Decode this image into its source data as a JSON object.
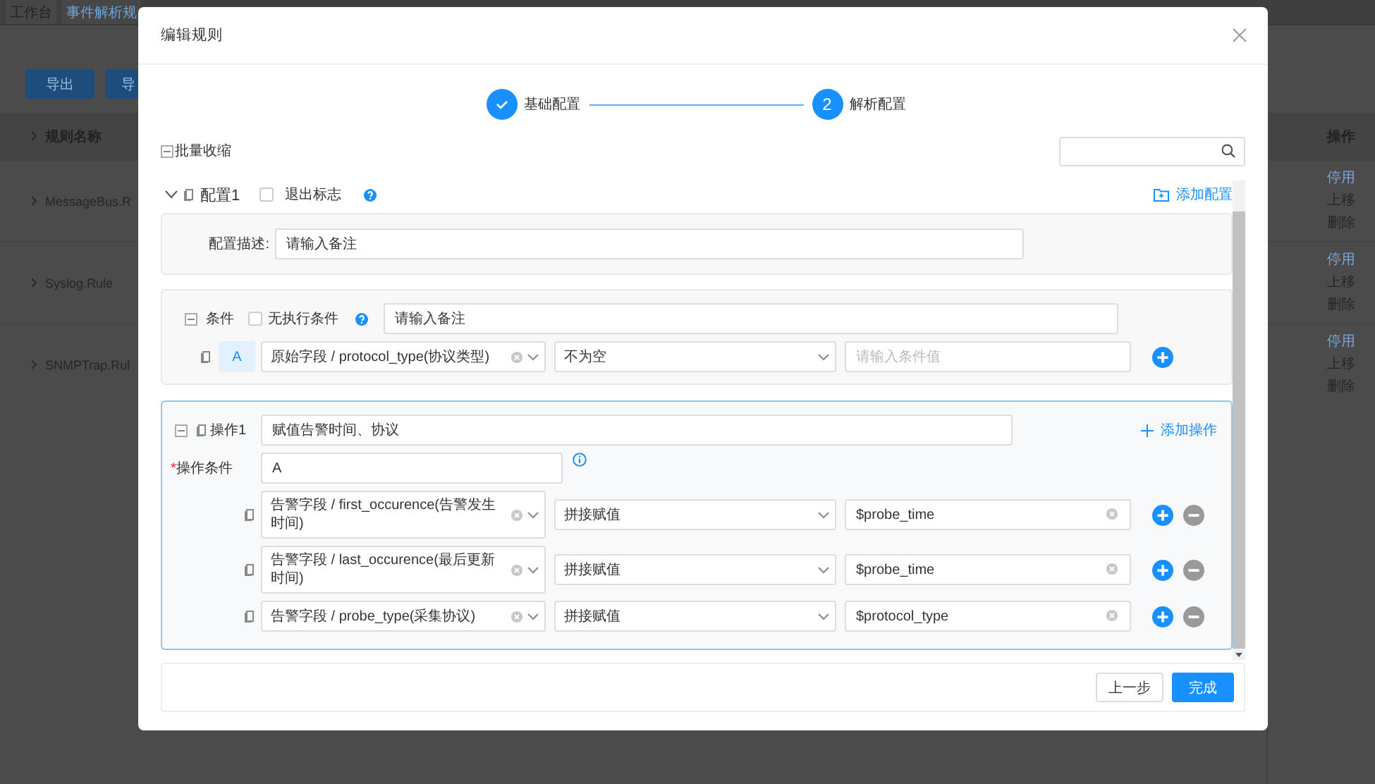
{
  "background": {
    "tabs": [
      {
        "label": "工作台",
        "selected": false
      },
      {
        "label": "事件解析规",
        "selected": true
      }
    ],
    "buttons": [
      "导出",
      "导"
    ],
    "table": {
      "columns": [
        "规则名称",
        "操作"
      ],
      "rows": [
        {
          "name": "MessageBus.R",
          "actions": [
            "停用",
            "上移",
            "删除"
          ]
        },
        {
          "name": "Syslog.Rule",
          "actions": [
            "停用",
            "上移",
            "删除"
          ]
        },
        {
          "name": "SNMPTrap.Rul",
          "actions": [
            "停用",
            "上移",
            "删除"
          ]
        }
      ]
    }
  },
  "dialog": {
    "title": "编辑规则",
    "steps": [
      {
        "label": "基础配置",
        "done": true
      },
      {
        "label": "解析配置",
        "number": "2",
        "done": false
      }
    ],
    "collapse_all": "批量收缩",
    "config": {
      "title": "配置1",
      "expanded": true,
      "exit_flag": {
        "label": "退出标志",
        "checked": false
      },
      "add_link": "添加配置",
      "description": {
        "label": "配置描述:",
        "value": "请输入备注"
      },
      "condition": {
        "label": "条件",
        "expanded": true,
        "no_exec": {
          "label": "无执行条件",
          "checked": false
        },
        "note": "请输入备注",
        "rows": [
          {
            "tag": "A",
            "field": "原始字段 / protocol_type(协议类型)",
            "operator": "不为空",
            "placeholder": "请输入条件值"
          }
        ]
      },
      "operation": {
        "title": "操作1",
        "expanded": true,
        "name": "赋值告警时间、协议",
        "add_link": "添加操作",
        "condition_label": "操作条件",
        "required_mark": "*",
        "condition_value": "A",
        "rows": [
          {
            "field": "告警字段 / first_occurence(告警发生时间)",
            "method": "拼接赋值",
            "value": "$probe_time"
          },
          {
            "field": "告警字段 / last_occurence(最后更新时间)",
            "method": "拼接赋值",
            "value": "$probe_time"
          },
          {
            "field": "告警字段 / probe_type(采集协议)",
            "method": "拼接赋值",
            "value": "$protocol_type"
          }
        ]
      }
    },
    "footer": [
      {
        "label": "上一步",
        "kind": "default"
      },
      {
        "label": "完成",
        "kind": "primary"
      }
    ]
  }
}
